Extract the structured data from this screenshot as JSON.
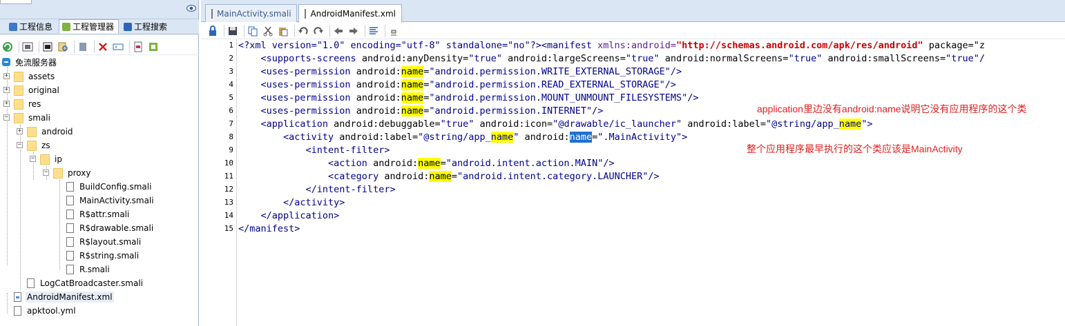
{
  "left_panel": {
    "tabs": [
      {
        "label": "工程信息"
      },
      {
        "label": "工程管理器"
      },
      {
        "label": "工程搜索"
      }
    ],
    "root_label": "免流服务器",
    "tree": [
      {
        "label": "assets"
      },
      {
        "label": "original"
      },
      {
        "label": "res"
      },
      {
        "label": "smali"
      },
      {
        "label": "android"
      },
      {
        "label": "zs"
      },
      {
        "label": "ip"
      },
      {
        "label": "proxy"
      },
      {
        "label": "BuildConfig.smali"
      },
      {
        "label": "MainActivity.smali"
      },
      {
        "label": "R$attr.smali"
      },
      {
        "label": "R$drawable.smali"
      },
      {
        "label": "R$layout.smali"
      },
      {
        "label": "R$string.smali"
      },
      {
        "label": "R.smali"
      },
      {
        "label": "LogCatBroadcaster.smali"
      },
      {
        "label": "AndroidManifest.xml"
      },
      {
        "label": "apktool.yml"
      }
    ]
  },
  "editor": {
    "tabs": [
      {
        "label": "MainActivity.smali"
      },
      {
        "label": "AndroidManifest.xml"
      }
    ],
    "line_numbers": [
      "1",
      "2",
      "3",
      "4",
      "5",
      "6",
      "7",
      "8",
      "9",
      "10",
      "11",
      "12",
      "13",
      "14",
      "15"
    ],
    "annotations": [
      "application里边没有android:name说明它没有应用程序的这个类",
      "整个应用程序最早执行的这个类应该是MainActivity"
    ]
  },
  "code": {
    "l1": {
      "a": "<?xml version=\"1.0\" encoding=\"utf-8\" standalone=\"no\"?><manifest ",
      "b": "xmlns:android=",
      "c": "\"http://schemas.android.com/apk/res/android\"",
      "d": " package=\"z"
    },
    "l2": {
      "a": "    <supports-screens",
      "b": " android:anyDensity=",
      "c": "\"true\"",
      "d": " android:largeScreens=",
      "e": "\"true\"",
      "f": " android:normalScreens=",
      "g": "\"true\"",
      "h": " android:smallScreens=",
      "i": "\"true\"/"
    },
    "l3": {
      "a": "    <uses-permission",
      "b": " android:",
      "c": "name",
      "d": "=",
      "e": "\"android.permission.WRITE_EXTERNAL_STORAGE\"/>"
    },
    "l4": {
      "a": "    <uses-permission",
      "b": " android:",
      "c": "name",
      "d": "=",
      "e": "\"android.permission.READ_EXTERNAL_STORAGE\"/>"
    },
    "l5": {
      "a": "    <uses-permission",
      "b": " android:",
      "c": "name",
      "d": "=",
      "e": "\"android.permission.MOUNT_UNMOUNT_FILESYSTEMS\"/>"
    },
    "l6": {
      "a": "    <uses-permission",
      "b": " android:",
      "c": "name",
      "d": "=",
      "e": "\"android.permission.INTERNET\"/>"
    },
    "l7": {
      "a": "    <application",
      "b": " android:debuggable=",
      "c": "\"true\"",
      "d": " android:icon=",
      "e": "\"@drawable/ic_launcher\"",
      "f": " android:label=",
      "g": "\"@string/app_",
      "h": "name",
      "i": "\">"
    },
    "l8": {
      "a": "        <activity",
      "b": " android:label=",
      "c": "\"@string/app_",
      "d": "name",
      "e": "\"",
      "f": " android:",
      "g": "name",
      "h": "=",
      "i": "\".MainActivity\">"
    },
    "l9": {
      "a": "            <intent-filter>"
    },
    "l10": {
      "a": "                <action",
      "b": " android:",
      "c": "name",
      "d": "=",
      "e": "\"android.intent.action.MAIN\"/>"
    },
    "l11": {
      "a": "                <category",
      "b": " android:",
      "c": "name",
      "d": "=",
      "e": "\"android.intent.category.LAUNCHER\"/>"
    },
    "l12": {
      "a": "            </intent-filter>"
    },
    "l13": {
      "a": "        </activity>"
    },
    "l14": {
      "a": "    </application>"
    },
    "l15": {
      "a": "</manifest>"
    }
  }
}
